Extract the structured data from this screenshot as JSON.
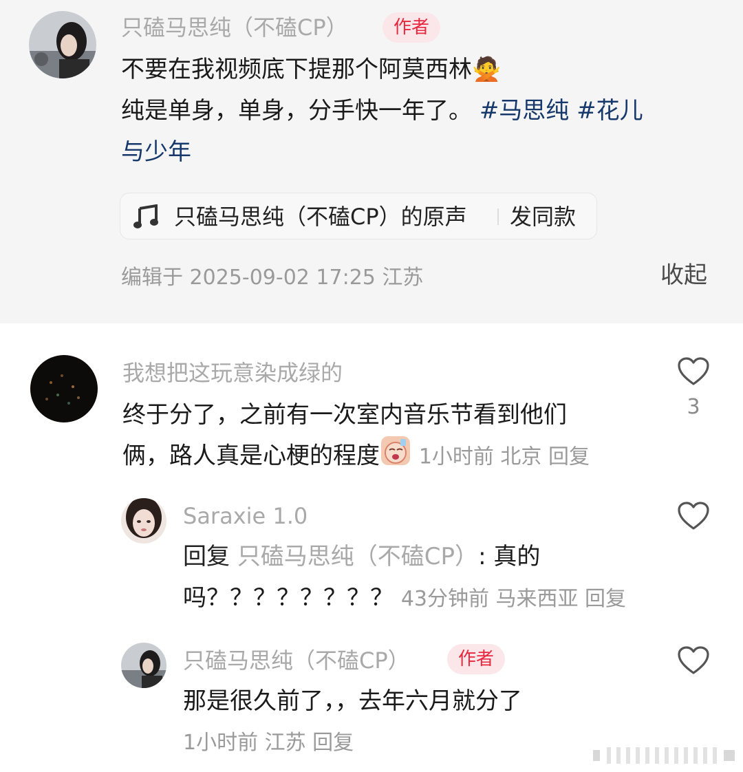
{
  "post": {
    "author": "只磕马思纯（不磕CP）",
    "author_badge": "作者",
    "text_line1": "不要在我视频底下提那个阿莫西林",
    "text_line1_emoji": "🙅",
    "text_line2": "纯是单身，单身，分手快一年了。",
    "hashtag1": "#马思纯",
    "hashtag2_part1": "#花儿",
    "hashtag2_part2": "与少年",
    "music_label": "只磕马思纯（不磕CP）的原声",
    "music_action": "发同款",
    "edited_meta": "编辑于  2025-09-02 17:25  江苏",
    "collapse_label": "收起"
  },
  "comments": [
    {
      "username": "我想把这玩意染成绿的",
      "text_line1": "终于分了，之前有一次室内音乐节看到他们",
      "text_line2": "俩，路人真是心梗的程度",
      "meta": "1小时前 北京 回复",
      "likes": "3",
      "replies": [
        {
          "username": "Saraxie 1.0",
          "reply_prefix": "回复",
          "reply_target": "只磕马思纯（不磕CP）",
          "reply_text_after": ": 真的",
          "text_line2": "吗？？？？？？？？",
          "meta": "43分钟前 马来西亚 回复"
        },
        {
          "username": "只磕马思纯（不磕CP）",
          "badge": "作者",
          "text_line1": "那是很久前了，，去年六月就分了",
          "meta": "1小时前 江苏 回复"
        }
      ]
    }
  ],
  "colors": {
    "accent_badge_text": "#e8283e",
    "accent_badge_bg": "#fbe7ea",
    "hashtag": "#16386b",
    "muted": "#a9a9a9"
  },
  "icons": {
    "music": "music-note-icon",
    "like": "heart-outline-icon",
    "emoji_gesture": "person-gesturing-no-emoji",
    "emoji_face": "crying-face-sticker"
  }
}
